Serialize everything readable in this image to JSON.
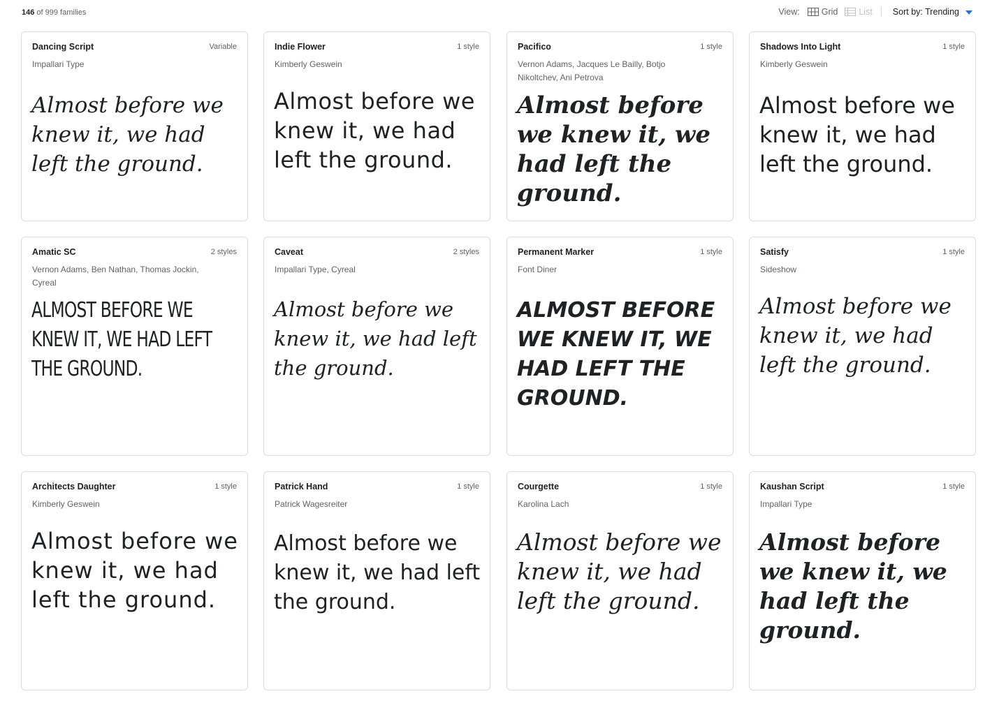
{
  "header": {
    "count": "146",
    "count_suffix": "of 999 families",
    "view_label": "View:",
    "grid_label": "Grid",
    "list_label": "List",
    "sort_label": "Sort by: Trending"
  },
  "cards": [
    {
      "name": "Dancing Script",
      "styles": "Variable",
      "designer": "Impallari Type",
      "sample": "Almost before we knew it, we had left the ground."
    },
    {
      "name": "Indie Flower",
      "styles": "1 style",
      "designer": "Kimberly Geswein",
      "sample": "Almost before we knew it, we had left the ground."
    },
    {
      "name": "Pacifico",
      "styles": "1 style",
      "designer": "Vernon Adams, Jacques Le Bailly, Botjo Nikoltchev, Ani Petrova",
      "sample": "Almost before we knew it, we had left the ground."
    },
    {
      "name": "Shadows Into Light",
      "styles": "1 style",
      "designer": "Kimberly Geswein",
      "sample": "Almost before we knew it, we had left the ground."
    },
    {
      "name": "Amatic SC",
      "styles": "2 styles",
      "designer": "Vernon Adams, Ben Nathan, Thomas Jockin, Cyreal",
      "sample": "ALMOST BEFORE WE KNEW IT, WE HAD LEFT THE GROUND."
    },
    {
      "name": "Caveat",
      "styles": "2 styles",
      "designer": "Impallari Type, Cyreal",
      "sample": "Almost before we knew it, we had left the ground."
    },
    {
      "name": "Permanent Marker",
      "styles": "1 style",
      "designer": "Font Diner",
      "sample": "ALMOST BEFORE WE KNEW IT, WE HAD LEFT THE GROUND."
    },
    {
      "name": "Satisfy",
      "styles": "1 style",
      "designer": "Sideshow",
      "sample": "Almost before we knew it, we had left the ground."
    },
    {
      "name": "Architects Daughter",
      "styles": "1 style",
      "designer": "Kimberly Geswein",
      "sample": "Almost before we knew it, we had left the ground."
    },
    {
      "name": "Patrick Hand",
      "styles": "1 style",
      "designer": "Patrick Wagesreiter",
      "sample": "Almost before we knew it, we had left the ground."
    },
    {
      "name": "Courgette",
      "styles": "1 style",
      "designer": "Karolina Lach",
      "sample": "Almost before we knew it, we had left the ground."
    },
    {
      "name": "Kaushan Script",
      "styles": "1 style",
      "designer": "Impallari Type",
      "sample": "Almost before we knew it, we had left the ground."
    }
  ]
}
